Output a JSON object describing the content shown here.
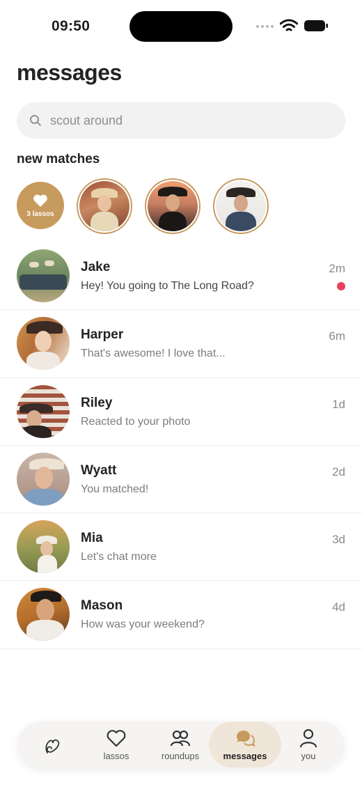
{
  "status_bar": {
    "time": "09:50"
  },
  "header": {
    "title": "messages"
  },
  "search": {
    "placeholder": "scout around",
    "value": ""
  },
  "new_matches": {
    "title": "new matches",
    "lasso_count_label": "3 lassos",
    "avatars": [
      "match-1",
      "match-2",
      "match-3"
    ]
  },
  "threads": [
    {
      "name": "Jake",
      "preview": "Hey! You going to The Long Road?",
      "time": "2m",
      "unread": true
    },
    {
      "name": "Harper",
      "preview": "That's awesome! I love that...",
      "time": "6m",
      "unread": false
    },
    {
      "name": "Riley",
      "preview": "Reacted to your photo",
      "time": "1d",
      "unread": false
    },
    {
      "name": "Wyatt",
      "preview": "You matched!",
      "time": "2d",
      "unread": false
    },
    {
      "name": "Mia",
      "preview": "Let's chat more",
      "time": "3d",
      "unread": false
    },
    {
      "name": "Mason",
      "preview": "How was your weekend?",
      "time": "4d",
      "unread": false
    }
  ],
  "tab_bar": {
    "items": [
      {
        "label": "",
        "icon": "lasso-heart-icon"
      },
      {
        "label": "lassos",
        "icon": "heart-icon"
      },
      {
        "label": "roundups",
        "icon": "people-icon"
      },
      {
        "label": "messages",
        "icon": "chat-bubbles-icon",
        "active": true
      },
      {
        "label": "you",
        "icon": "person-icon"
      }
    ]
  },
  "colors": {
    "accent": "#c79a5e",
    "unread_dot": "#e8415e"
  }
}
